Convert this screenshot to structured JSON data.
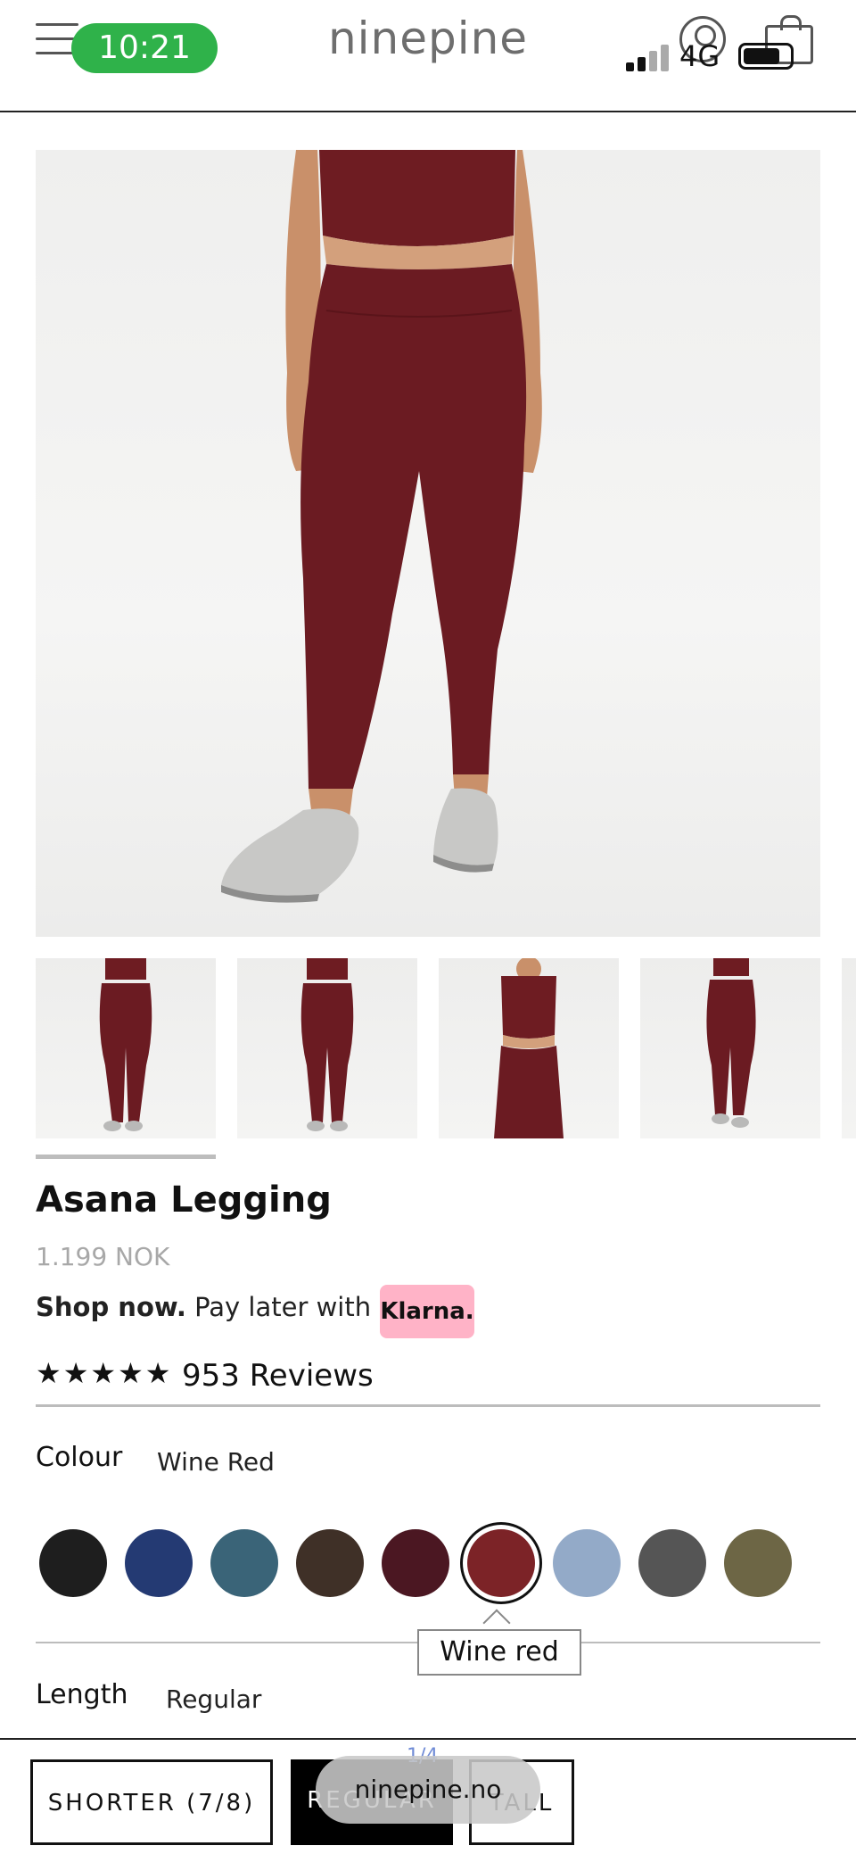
{
  "status_bar": {
    "time": "10:21",
    "network": "4G",
    "time_pill_color": "#2fb24a"
  },
  "header": {
    "brand": "ninepine",
    "icons": [
      "menu-icon",
      "user-icon",
      "bag-icon"
    ]
  },
  "product": {
    "name": "Asana Legging",
    "price": "1.199 NOK",
    "klarna_strong": "Shop now.",
    "klarna_text": "Pay later with",
    "klarna_badge": "Klarna.",
    "klarna_badge_color": "#ffb3c7",
    "rating_stars": "★★★★★",
    "rating_value": 4.5,
    "reviews": "953 Reviews"
  },
  "colour": {
    "label": "Colour",
    "selected": "Wine Red",
    "tooltip": "Wine red",
    "swatches": [
      {
        "name": "black",
        "color": "#1e1e1e"
      },
      {
        "name": "navy",
        "color": "#243a73"
      },
      {
        "name": "petrol",
        "color": "#3a6478"
      },
      {
        "name": "brown",
        "color": "#3f3027"
      },
      {
        "name": "plum",
        "color": "#4b1722"
      },
      {
        "name": "wine-red",
        "color": "#7c2327",
        "selected": true
      },
      {
        "name": "light-blue",
        "color": "#93aac8"
      },
      {
        "name": "grey",
        "color": "#555555"
      },
      {
        "name": "olive",
        "color": "#6d6645"
      }
    ]
  },
  "length": {
    "label": "Length",
    "selected": "Regular",
    "options": [
      "SHORTER (7/8)",
      "REGULAR",
      "TALL"
    ]
  },
  "browser": {
    "url": "ninepine.no",
    "page_indicator": "1/4"
  }
}
